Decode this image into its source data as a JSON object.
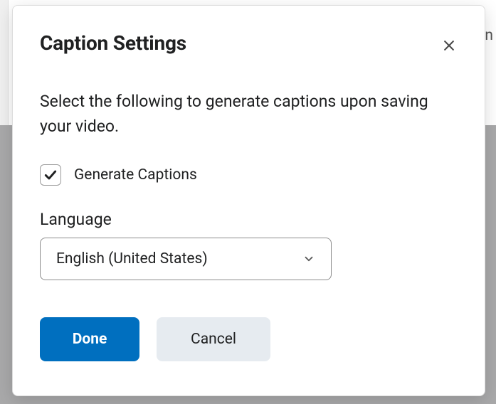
{
  "dialog": {
    "title": "Caption Settings",
    "description": "Select the following to generate captions upon saving your video.",
    "checkbox_label": "Generate Captions",
    "checkbox_checked": true,
    "language_label": "Language",
    "language_value": "English (United States)",
    "done_label": "Done",
    "cancel_label": "Cancel"
  }
}
